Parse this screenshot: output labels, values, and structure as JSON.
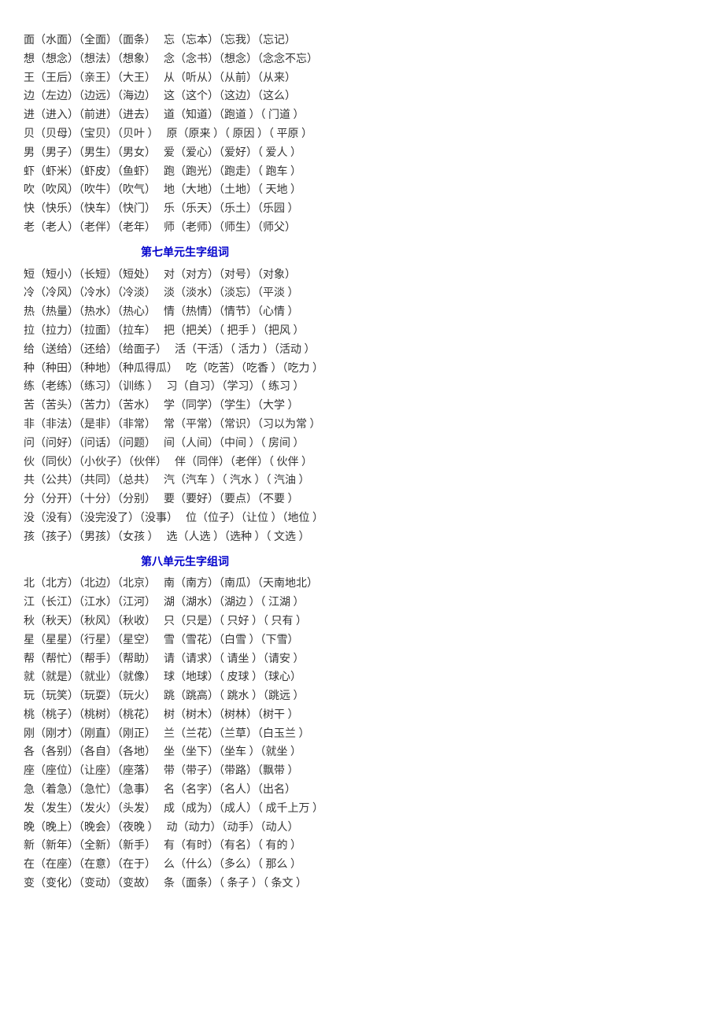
{
  "sections": [
    {
      "heading": null,
      "rows": [
        [
          "面（水面）（全面）（面条）",
          "忘（忘本）（忘我）（忘记）"
        ],
        [
          "想（想念）（想法）（想象）",
          "念（念书）（想念）（念念不忘）"
        ],
        [
          "王（王后）（亲王）（大王）",
          "从（听从）（从前）（从来）"
        ],
        [
          "边（左边）（边远）（海边）",
          "这（这个）（这边）（这么）"
        ],
        [
          "进（进入）（前进）（进去）",
          "道（知道）（跑道 ）（ 门道 ）"
        ],
        [
          "贝（贝母）（宝贝）（贝叶 ）",
          "原（原来 ）（ 原因 ）（ 平原 ）"
        ],
        [
          "男（男子）（男生）（男女）",
          "爱（爱心）（爱好）（ 爱人 ）"
        ],
        [
          "虾（虾米）（虾皮）（鱼虾）",
          "跑（跑光）（跑走）（ 跑车 ）"
        ],
        [
          "吹（吹风）（吹牛）（吹气）",
          "地（大地）（土地）（ 天地 ）"
        ],
        [
          "快（快乐）（快车）（快门）",
          "乐（乐天）（乐土）（乐园 ）"
        ],
        [
          "老（老人）（老伴）（老年）",
          "师（老师）（师生）（师父）"
        ]
      ]
    },
    {
      "heading": "第七单元生字组词",
      "rows": [
        [
          "短（短小）（长短）（短处）",
          "对（对方）（对号）（对象）"
        ],
        [
          "冷（冷风）（冷水）（冷淡）",
          "淡（淡水）（淡忘）（平淡 ）"
        ],
        [
          "热（热量）（热水）（热心）",
          "情（热情）（情节）（心情 ）"
        ],
        [
          "拉（拉力）（拉面）（拉车）",
          "把（把关）（ 把手 ）（把风 ）"
        ],
        [
          "给（送给）（还给）（给面子）",
          "活（干活）（ 活力 ）（活动 ）"
        ],
        [
          "种（种田）（种地）（种瓜得瓜）",
          "吃（吃苦）（吃香 ）（吃力 ）"
        ],
        [
          "练（老练）（练习）（训练 ）",
          "习（自习）（学习）（ 练习 ）"
        ],
        [
          "苦（苦头）（苦力）（苦水）",
          "学（同学）（学生）（大学 ）"
        ],
        [
          "非（非法）（是非）（非常）",
          "常（平常）（常识）（习以为常 ）"
        ],
        [
          "问（问好）（问话）（问题）",
          "间（人间）（中间 ）（ 房间 ）"
        ],
        [
          "伙（同伙）（小伙子）（伙伴）",
          "伴（同伴）（老伴）（ 伙伴 ）"
        ],
        [
          "共（公共）（共同）（总共）",
          "汽（汽车 ）（ 汽水 ）（ 汽油 ）"
        ],
        [
          "分（分开）（十分）（分别）",
          "要（要好）（要点）（不要 ）"
        ],
        [
          "没（没有）（没完没了）（没事）",
          "位（位子）（让位 ）（地位 ）"
        ],
        [
          "孩（孩子）（男孩）（女孩 ）",
          "选（人选 ）（选种 ）（ 文选 ）"
        ]
      ]
    },
    {
      "heading": "第八单元生字组词",
      "rows": [
        [
          "北（北方）（北边）（北京）",
          "南（南方）（南瓜）（天南地北）"
        ],
        [
          "江（长江）（江水）（江河）",
          "湖（湖水）（湖边 ）（ 江湖 ）"
        ],
        [
          "秋（秋天）（秋风）（秋收）",
          "只（只是）（ 只好 ）（ 只有 ）"
        ],
        [
          "星（星星）（行星）（星空）",
          "雪（雪花）（白雪 ）（下雪）"
        ],
        [
          "帮（帮忙）（帮手）（帮助）",
          "请（请求）（ 请坐 ）（请安 ）"
        ],
        [
          "就（就是）（就业）（就像）",
          "球（地球）（ 皮球 ）（球心）"
        ],
        [
          "玩（玩笑）（玩耍）（玩火）",
          "跳（跳高）（ 跳水 ）（跳远 ）"
        ],
        [
          "桃（桃子）（桃树）（桃花）",
          "树（树木）（树林）（树干 ）"
        ],
        [
          "刚（刚才）（刚直）（刚正）",
          "兰（兰花）（兰草）（白玉兰 ）"
        ],
        [
          "各（各别）（各自）（各地）",
          "坐（坐下）（坐车 ）（就坐 ）"
        ],
        [
          "座（座位）（让座）（座落）",
          "带（带子）（带路）（飘带 ）"
        ],
        [
          "急（着急）（急忙）（急事）",
          "名（名字）（名人）（出名）"
        ],
        [
          "发（发生）（发火）（头发）",
          "成（成为）（成人）（ 成千上万 ）"
        ],
        [
          "晚（晚上）（晚会）（夜晚 ）",
          "动（动力）（动手）（动人）"
        ],
        [
          "新（新年）（全新）（新手）",
          "有（有时）（有名）（ 有的 ）"
        ],
        [
          "在（在座）（在意）（在于）",
          "么（什么）（多么）（ 那么 ）"
        ],
        [
          "变（变化）（变动）（变故）",
          "条（面条）（ 条子 ）（ 条文 ）"
        ]
      ]
    }
  ]
}
